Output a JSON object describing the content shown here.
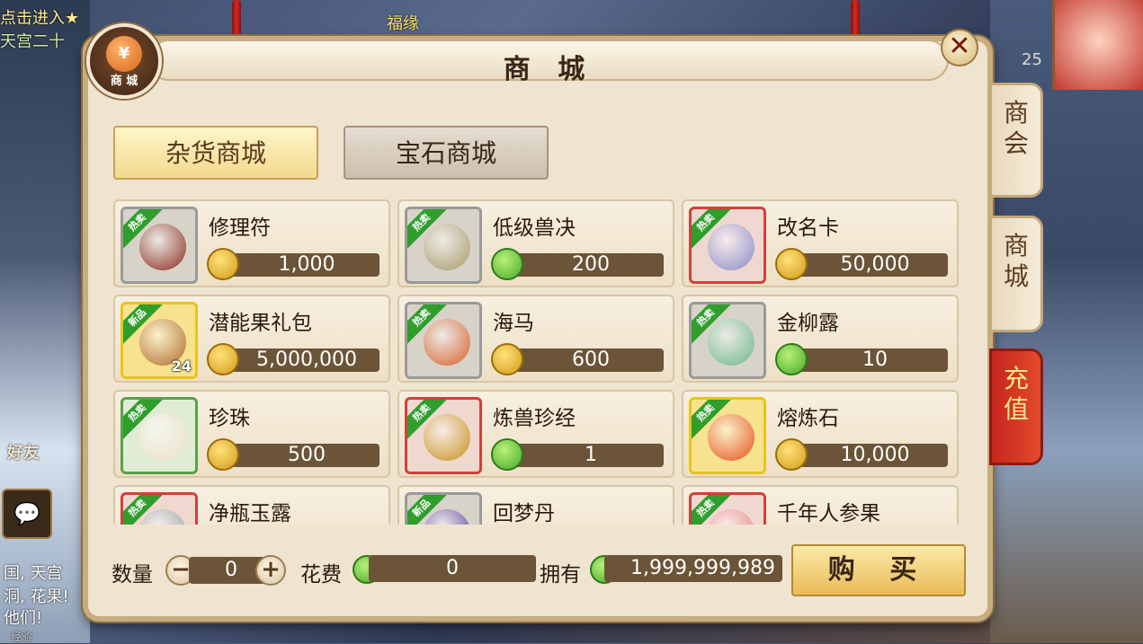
{
  "background": {
    "top_left_text_1": "点击进入★",
    "top_left_text_2": "天宫二十",
    "top_center_text": "福缘",
    "friends_label": "好友",
    "chat_text_1": "国, 天宫",
    "chat_text_2": "洞, 花果!",
    "chat_text_3": "他们!",
    "bottom_text": "经验",
    "level": "25"
  },
  "shop": {
    "title": "商 城",
    "emblem_label": "商 城",
    "emblem_symbol": "¥",
    "close_symbol": "✕",
    "side_tabs": [
      {
        "label": "商会"
      },
      {
        "label": "商城"
      },
      {
        "label": "充值"
      }
    ],
    "categories": [
      {
        "label": "杂货商城",
        "active": true
      },
      {
        "label": "宝石商城",
        "active": false
      }
    ],
    "items": [
      {
        "name": "修理符",
        "badge": "热卖",
        "currency": "gold",
        "price": "1,000",
        "frame": "gray",
        "icon_color": "#8a2a1a"
      },
      {
        "name": "低级兽决",
        "badge": "热卖",
        "currency": "jade",
        "price": "200",
        "frame": "gray",
        "icon_color": "#a89a6a"
      },
      {
        "name": "改名卡",
        "badge": "热卖",
        "currency": "gold",
        "price": "50,000",
        "frame": "red",
        "icon_color": "#8a8ac8"
      },
      {
        "name": "潜能果礼包",
        "badge": "新品",
        "currency": "gold",
        "price": "5,000,000",
        "frame": "gold",
        "icon_color": "#b06a2a",
        "stack": "24"
      },
      {
        "name": "海马",
        "badge": "热卖",
        "currency": "gold",
        "price": "600",
        "frame": "gray",
        "icon_color": "#d8602a"
      },
      {
        "name": "金柳露",
        "badge": "热卖",
        "currency": "jade",
        "price": "10",
        "frame": "gray",
        "icon_color": "#6ab88a"
      },
      {
        "name": "珍珠",
        "badge": "热卖",
        "currency": "gold",
        "price": "500",
        "frame": "green",
        "icon_color": "#f0e0c8"
      },
      {
        "name": "炼兽珍经",
        "badge": "热卖",
        "currency": "jade",
        "price": "1",
        "frame": "red",
        "icon_color": "#c8901a"
      },
      {
        "name": "熔炼石",
        "badge": "热卖",
        "currency": "gold",
        "price": "10,000",
        "frame": "gold",
        "icon_color": "#e8501a"
      },
      {
        "name": "净瓶玉露",
        "badge": "热卖",
        "currency": "gold",
        "price": "",
        "frame": "red",
        "icon_color": "#8aa0a0"
      },
      {
        "name": "回梦丹",
        "badge": "新品",
        "currency": "gold",
        "price": "",
        "frame": "gray",
        "icon_color": "#5a3aa0"
      },
      {
        "name": "千年人参果",
        "badge": "热卖",
        "currency": "gold",
        "price": "",
        "frame": "red",
        "icon_color": "#e8787a"
      }
    ],
    "footer": {
      "quantity_label": "数量",
      "minus": "−",
      "plus": "+",
      "quantity_value": "0",
      "cost_label": "花费",
      "cost_value": "0",
      "own_label": "拥有",
      "own_value": "1,999,999,989",
      "buy_label": "购 买"
    },
    "chat_icon_symbol": "💬"
  },
  "colors": {
    "panel_bg": "#efe4d0",
    "price_bar": "#6b5437",
    "ribbon_green": "#2f9e2c",
    "recharge_red": "#c7261d"
  }
}
